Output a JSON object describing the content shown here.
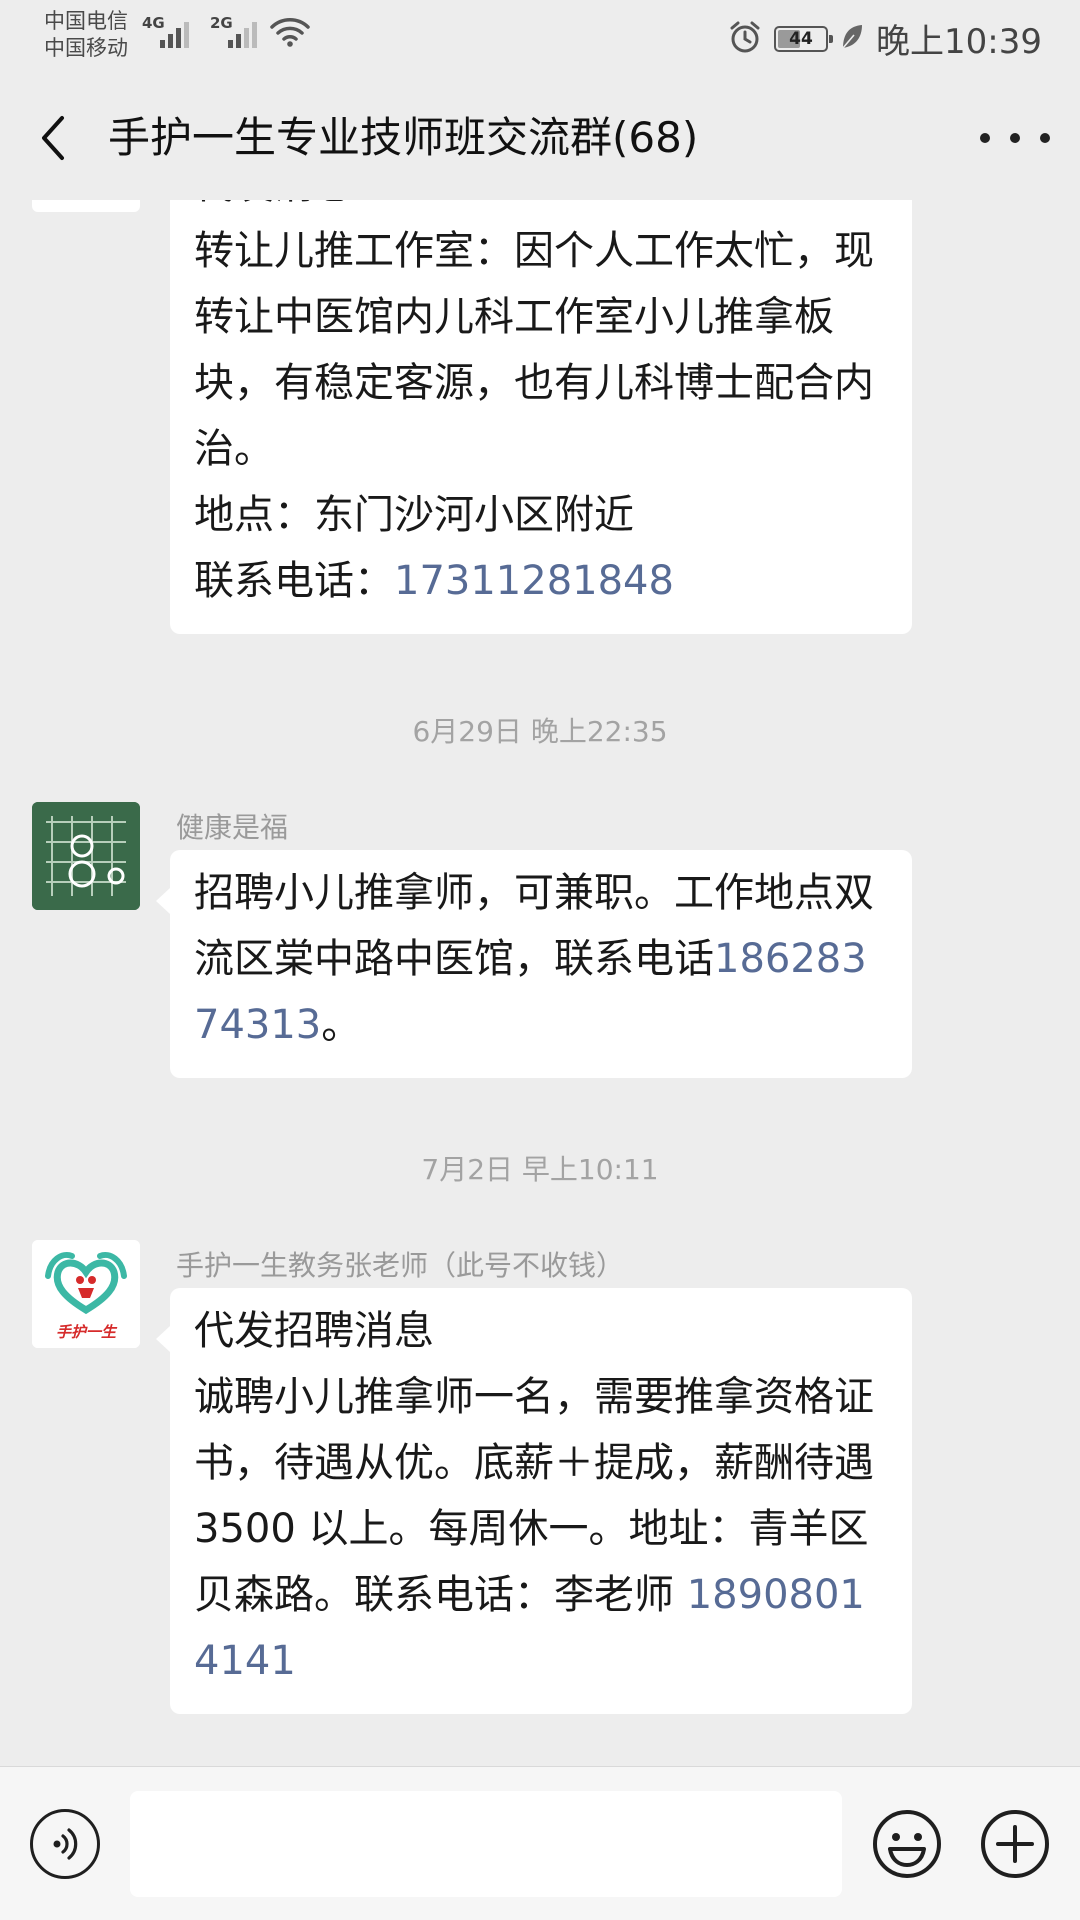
{
  "status_bar": {
    "carrier_1": "中国电信",
    "carrier_2": "中国移动",
    "network_1": "4G",
    "network_2": "2G",
    "battery": "44",
    "time": "晚上10:39"
  },
  "nav": {
    "title": "手护一生专业技师班交流群(68)"
  },
  "messages": [
    {
      "lines_before_phone": "代发消息：\n转让儿推工作室：因个人工作太忙，现转让中医馆内儿科工作室小儿推拿板块，有稳定客源，也有儿科博士配合内治。\n地点：东门沙河小区附近\n联系电话：",
      "phone": "17311281848",
      "after_phone": ""
    },
    {
      "timestamp": "6月29日 晚上22:35",
      "sender": "健康是福",
      "lines_before_phone": "招聘小儿推拿师，可兼职。工作地点双流区棠中路中医馆，联系电话",
      "phone": "18628374313",
      "after_phone": "。"
    },
    {
      "timestamp": "7月2日 早上10:11",
      "sender": "手护一生教务张老师（此号不收钱）",
      "avatar_text": "手护一生",
      "lines_before_phone": "代发招聘消息\n诚聘小儿推拿师一名，需要推拿资格证书，待遇从优。底薪＋提成，薪酬待遇 3500 以上。每周休一。地址：青羊区贝森路。联系电话：李老师 ",
      "phone": "18908014141",
      "after_phone": ""
    }
  ],
  "input": {
    "value": ""
  },
  "colors": {
    "background": "#ededed",
    "bubble": "#ffffff",
    "link": "#576b95",
    "meta_text": "#9a9a9a"
  },
  "icons": [
    "back-icon",
    "more-icon",
    "voice-icon",
    "emoji-icon",
    "add-icon",
    "alarm-icon",
    "wifi-icon",
    "battery-icon",
    "leaf-icon"
  ]
}
